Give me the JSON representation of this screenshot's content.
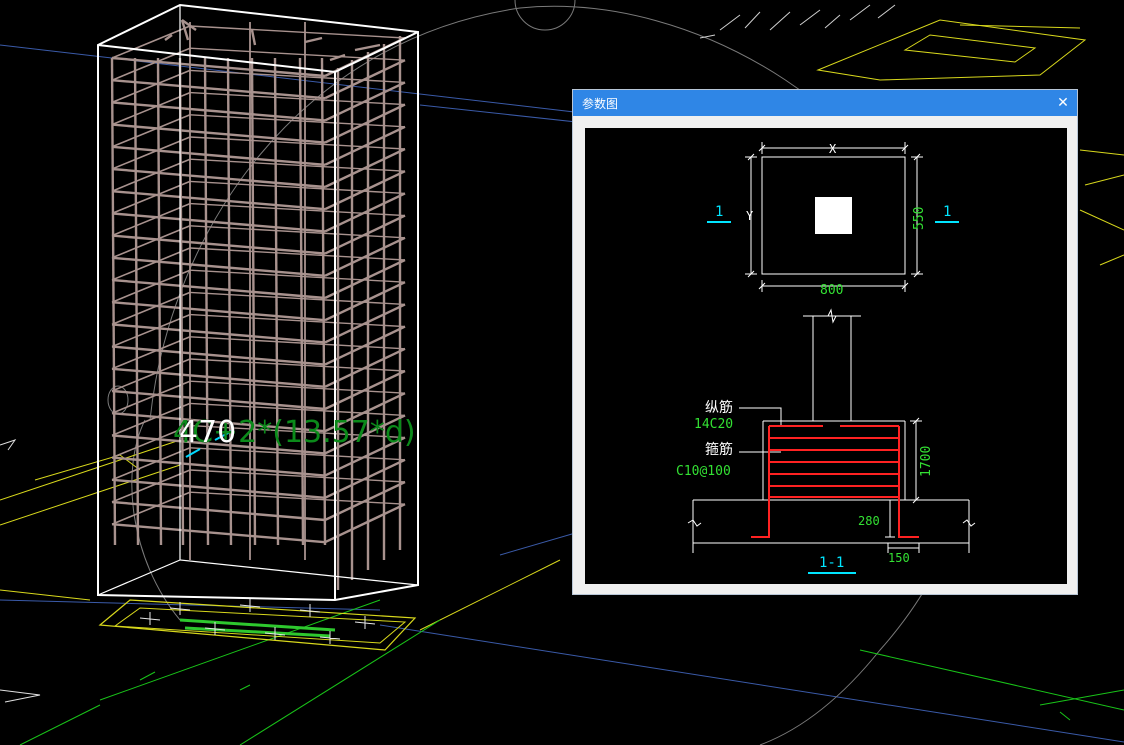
{
  "viewport": {
    "dimension_formula": "4C+2*(13.57*d)",
    "dimension_value": "470"
  },
  "dialog": {
    "title": "参数图",
    "close_icon": "close-icon",
    "plan": {
      "x_label": "X",
      "y_label": "Y",
      "width_value": "800",
      "height_value": "550",
      "section_mark_left": "1",
      "section_mark_right": "1"
    },
    "section": {
      "longitudinal_label": "纵筋",
      "longitudinal_value": "14C20",
      "stirrup_label": "箍筋",
      "stirrup_value": "C10@100",
      "height_value": "1700",
      "embed_value": "280",
      "cover_value": "150",
      "section_title": "1-1"
    },
    "colors": {
      "title_bar": "#2f86e6",
      "cad_text": "#33e033",
      "rebar": "#ff2222",
      "section_mark": "#00e5ff"
    }
  }
}
